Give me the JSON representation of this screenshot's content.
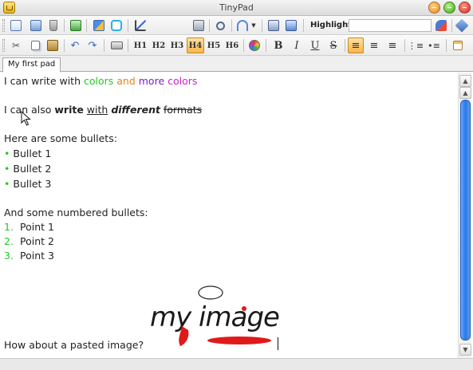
{
  "window": {
    "title": "TinyPad"
  },
  "toolbar1": {
    "icons": [
      "new-icon",
      "save-icon",
      "delete-icon",
      "export-icon",
      "spellcheck-icon",
      "twitter-icon",
      "stats-icon",
      "print-preview-icon",
      "search-icon",
      "broadcast-icon",
      "dropdown-arrow-icon",
      "paste-icon",
      "copy-doc-icon",
      "highlight-clear-icon",
      "pin-icon"
    ],
    "highlight_label": "Highlight:",
    "highlight_value": ""
  },
  "toolbar2": {
    "headings": [
      "H1",
      "H2",
      "H3",
      "H4",
      "H5",
      "H6"
    ],
    "active_heading": "H4",
    "format": {
      "bold": "B",
      "italic": "I",
      "underline": "U",
      "strike": "S"
    },
    "active_align": "left"
  },
  "tab": {
    "label": "My first pad"
  },
  "colors": {
    "green": "#22cc22",
    "orange": "#e8821a",
    "purple": "#7a1ec8",
    "magenta": "#d01ed0",
    "accent_blue": "#2a78e8"
  },
  "editor": {
    "line1": {
      "a": "I can write with ",
      "w1": "colors",
      "w2": " and ",
      "w3": "more",
      "w4": " ",
      "w5": "colors"
    },
    "line2": {
      "a": "I can also ",
      "b": "write",
      "c": " ",
      "d": "with",
      "e": " ",
      "f": "different",
      "g": " ",
      "h": "formats"
    },
    "bullets_heading": "Here are some bullets:",
    "bullets": [
      "Bullet 1",
      "Bullet 2",
      "Bullet 3"
    ],
    "numbered_heading": "And some numbered bullets:",
    "numbered": [
      {
        "n": "1.",
        "t": "Point 1"
      },
      {
        "n": "2.",
        "t": "Point 2"
      },
      {
        "n": "3.",
        "t": "Point 3"
      }
    ],
    "image_caption": "How about a pasted image?",
    "image_text": "my image"
  }
}
